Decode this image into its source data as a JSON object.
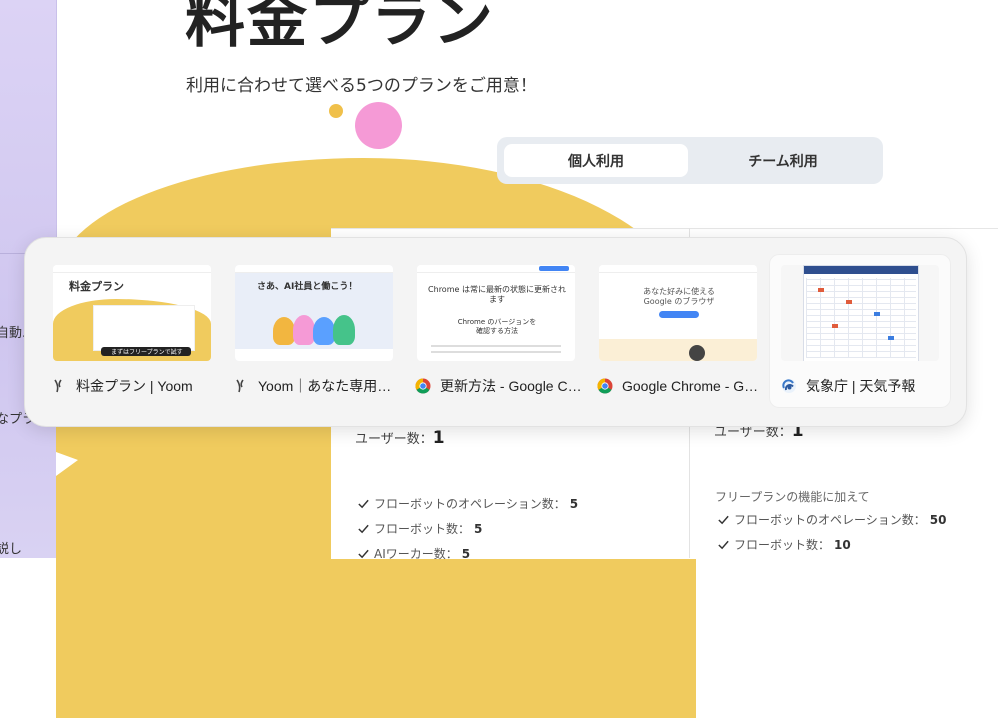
{
  "sidebar_fragments": [
    "自動.",
    "なプラ",
    "説し"
  ],
  "page": {
    "title": "料金プラン",
    "subtitle": "利用に合わせて選べる5つのプランをご用意！"
  },
  "plan_toggle": {
    "personal": "個人利用",
    "team": "チーム利用"
  },
  "plans": {
    "left": {
      "users_label": "ユーザー数：",
      "users_value": "1",
      "features": [
        {
          "label": "フローボットのオペレーション数：",
          "value": "5"
        },
        {
          "label": "フローボット数：",
          "value": "5"
        },
        {
          "label": "AIワーカー数：",
          "value": "5"
        }
      ]
    },
    "right": {
      "users_label": "ユーザー数：",
      "users_value": "1",
      "plus_note": "フリープランの機能に加えて",
      "features": [
        {
          "label": "フローボットのオペレーション数：",
          "value": "50"
        },
        {
          "label": "フローボット数：",
          "value": "10"
        }
      ]
    }
  },
  "tabs": [
    {
      "title": "料金プラン | Yoom",
      "favicon": "yoom-icon",
      "thumb": {
        "heading": "料金プラン",
        "button": "まずはフリープランで試す"
      }
    },
    {
      "title": "Yoom｜あなた専用のAI社員",
      "favicon": "yoom-icon",
      "thumb": {
        "heading": "さあ、AI社員と働こう！"
      }
    },
    {
      "title": "更新方法 - Google Chromeヘルプ",
      "favicon": "chrome-icon",
      "thumb": {
        "heading": "Chrome は常に最新の状態に更新されます",
        "sub": "Chrome のバージョンを確認する方法"
      }
    },
    {
      "title": "Google Chrome - Google のブラウザ",
      "favicon": "chrome-icon",
      "thumb": {
        "heading": "あなた好みに使える Google のブラウザ"
      }
    },
    {
      "title": "気象庁 | 天気予報",
      "favicon": "jma-icon",
      "thumb": {}
    }
  ],
  "colors": {
    "accent_yellow": "#f0cb5e",
    "accent_pink": "#f59ad6",
    "sidebar_lavender": "#d6cdf2",
    "chrome_red": "#db4437",
    "chrome_green": "#0f9d58",
    "chrome_yellow": "#f4b400",
    "chrome_blue": "#4285f4"
  }
}
